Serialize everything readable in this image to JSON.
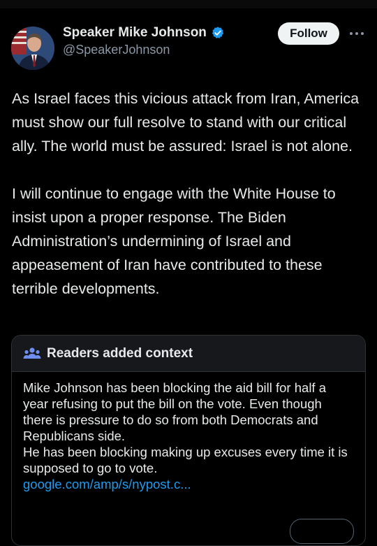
{
  "author": {
    "display_name": "Speaker Mike Johnson",
    "handle": "@SpeakerJohnson",
    "avatar_icon": "profile-photo",
    "verified_icon": "verified-badge-icon"
  },
  "actions": {
    "follow_label": "Follow",
    "more_icon": "more-icon"
  },
  "tweet": {
    "paragraphs": [
      "As Israel faces this vicious attack from Iran, America must show our full resolve to stand with our critical ally. The world must be assured: Israel is not alone.",
      "I will continue to engage with the White House to insist upon a proper response. The Biden Administration’s undermining of Israel and appeasement of Iran have contributed to these terrible developments."
    ]
  },
  "context_note": {
    "title": "Readers added context",
    "icon": "people-icon",
    "lines": [
      "Mike Johnson has been blocking the aid bill for half a year refusing to put the bill on the vote. Even though there is pressure to do so from both Democrats and Republicans side.",
      "He has been blocking making up excuses every time it is supposed to go to vote."
    ],
    "link_text": "google.com/amp/s/nypost.c..."
  },
  "colors": {
    "background": "#000000",
    "text": "#e7e9ea",
    "secondary_text": "#8b98a5",
    "link": "#1d9bf0",
    "verified": "#1d9bf0"
  }
}
